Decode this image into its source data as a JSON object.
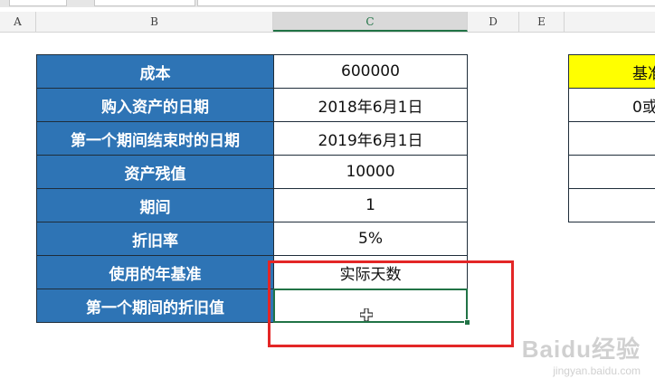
{
  "columns": [
    "A",
    "B",
    "C",
    "D",
    "E"
  ],
  "rows": [
    {
      "label": "成本",
      "value": "600000"
    },
    {
      "label": "购入资产的日期",
      "value": "2018年6月1日"
    },
    {
      "label": "第一个期间结束时的日期",
      "value": "2019年6月1日"
    },
    {
      "label": "资产残值",
      "value": "10000"
    },
    {
      "label": "期间",
      "value": "1"
    },
    {
      "label": "折旧率",
      "value": "5%"
    },
    {
      "label": "使用的年基准",
      "value": "实际天数"
    },
    {
      "label": "第一个期间的折旧值",
      "value": ""
    }
  ],
  "right_table": {
    "header": "基准",
    "row1": "0或"
  },
  "watermark": {
    "brand": "Baidu经验",
    "url": "jingyan.baidu.com"
  },
  "colors": {
    "label_bg": "#2e74b5",
    "highlight": "#e32626",
    "yellow": "#ffff00",
    "selection": "#217346"
  },
  "icons": [
    "cell-cursor-icon"
  ]
}
